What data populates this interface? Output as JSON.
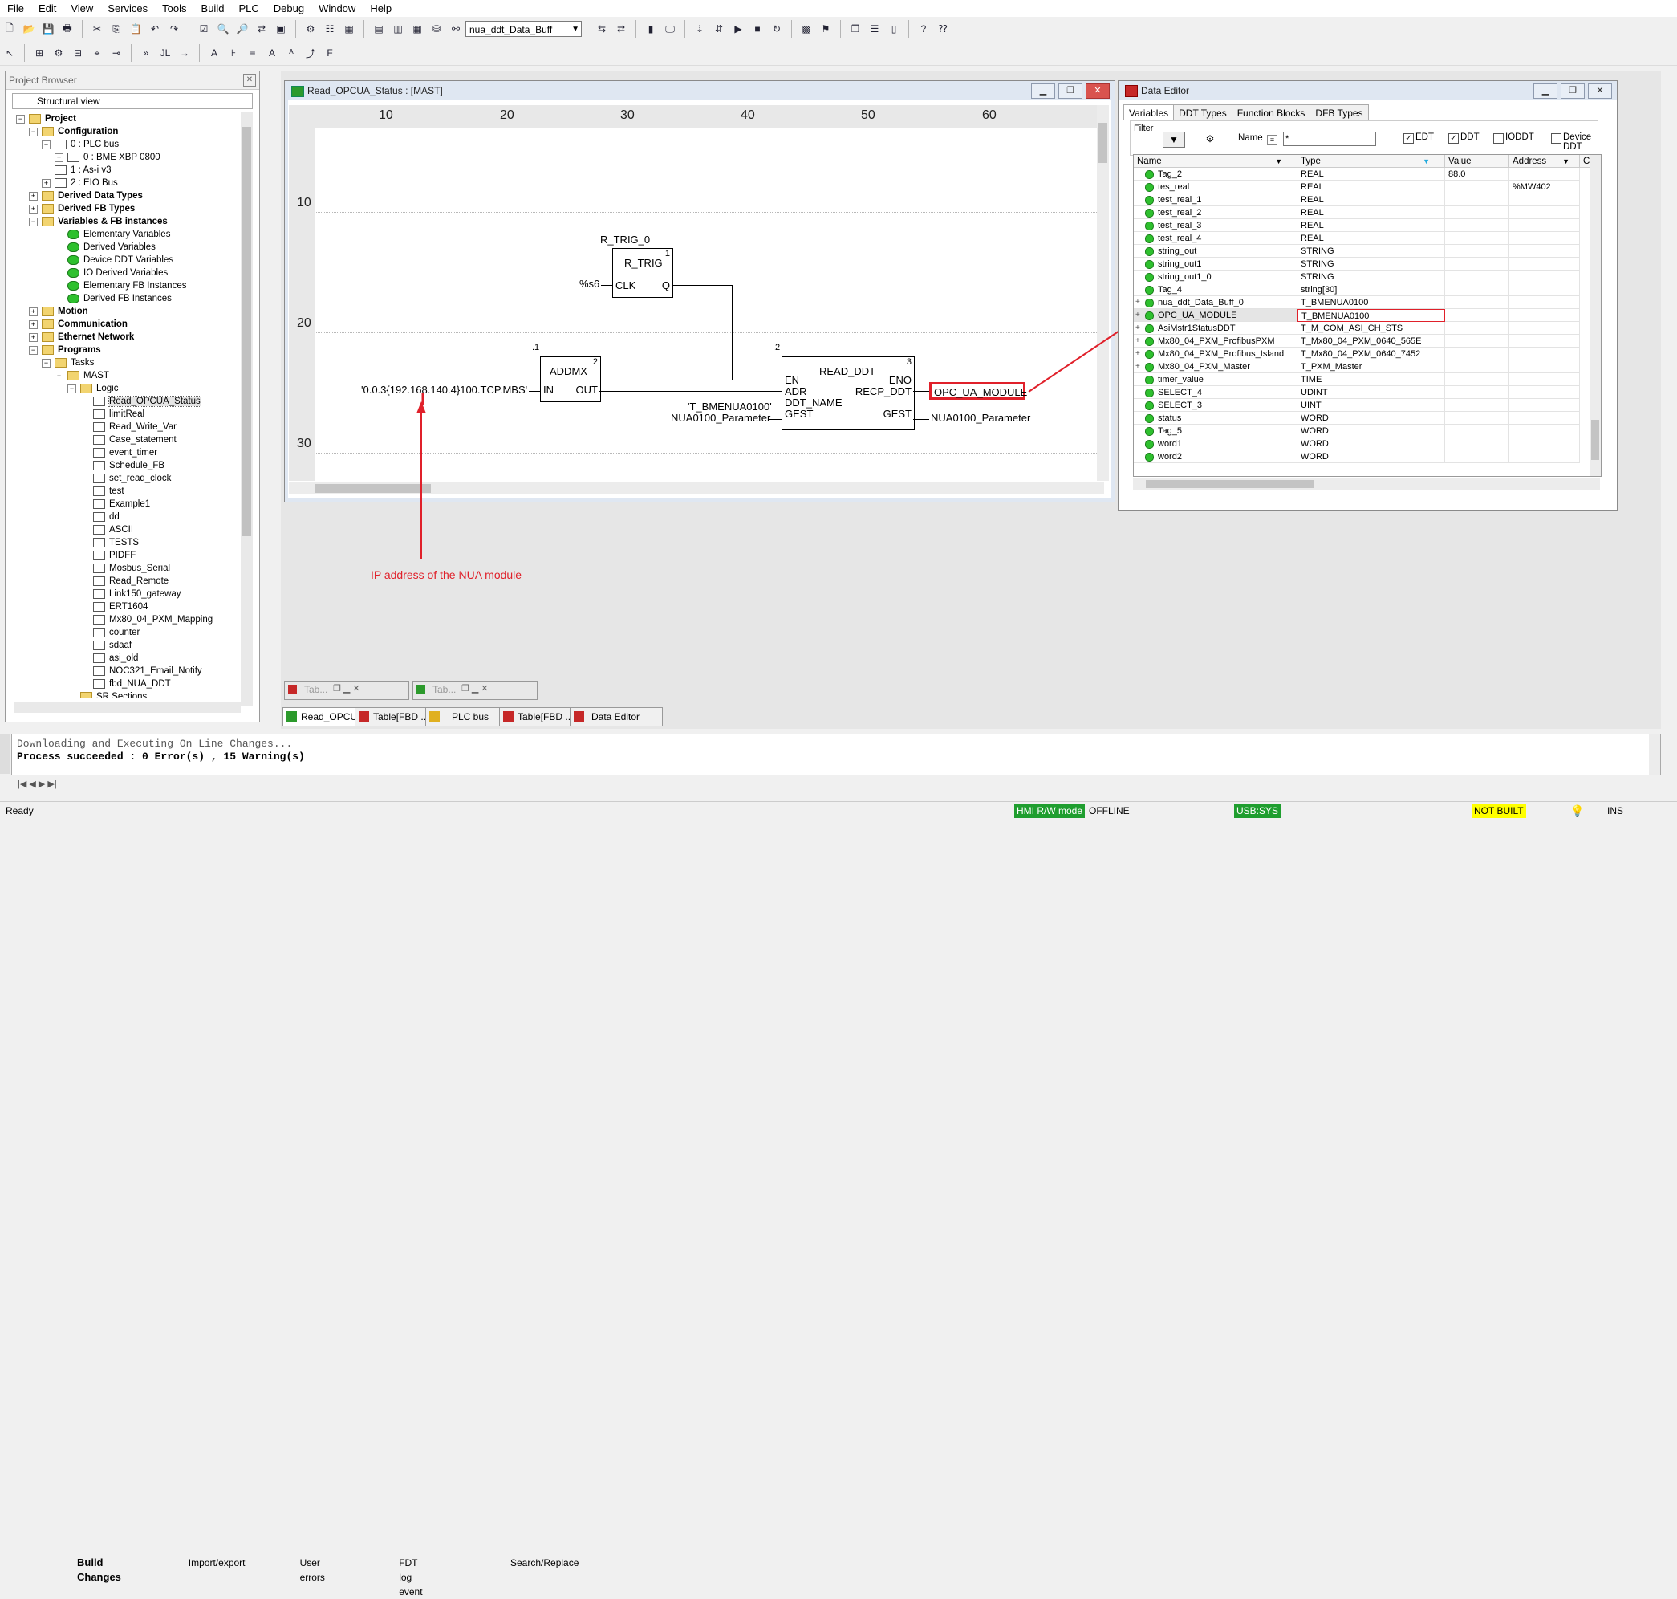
{
  "menu": [
    "File",
    "Edit",
    "View",
    "Services",
    "Tools",
    "Build",
    "PLC",
    "Debug",
    "Window",
    "Help"
  ],
  "toolbar": {
    "combo_value": "nua_ddt_Data_Buff"
  },
  "project_browser": {
    "title": "Project Browser",
    "view": "Structural view",
    "items": [
      {
        "label": "Project",
        "bold": true
      },
      {
        "label": "Configuration",
        "bold": true
      },
      {
        "label": "0 : PLC bus"
      },
      {
        "label": "0 : BME XBP 0800"
      },
      {
        "label": "1 : As-i v3"
      },
      {
        "label": "2 : EIO Bus"
      },
      {
        "label": "Derived Data Types",
        "bold": true
      },
      {
        "label": "Derived FB Types",
        "bold": true
      },
      {
        "label": "Variables & FB instances",
        "bold": true
      },
      {
        "label": "Elementary Variables"
      },
      {
        "label": "Derived Variables"
      },
      {
        "label": "Device DDT Variables"
      },
      {
        "label": "IO Derived Variables"
      },
      {
        "label": "Elementary FB Instances"
      },
      {
        "label": "Derived FB Instances"
      },
      {
        "label": "Motion",
        "bold": true
      },
      {
        "label": "Communication",
        "bold": true
      },
      {
        "label": "Ethernet Network",
        "bold": true
      },
      {
        "label": "Programs",
        "bold": true
      },
      {
        "label": "Tasks"
      },
      {
        "label": "MAST"
      },
      {
        "label": "Logic"
      },
      {
        "label": "Read_OPCUA_Status"
      },
      {
        "label": "limitReal"
      },
      {
        "label": "Read_Write_Var"
      },
      {
        "label": "Case_statement"
      },
      {
        "label": "event_timer"
      },
      {
        "label": "Schedule_FB"
      },
      {
        "label": "set_read_clock"
      },
      {
        "label": "test"
      },
      {
        "label": "Example1"
      },
      {
        "label": "dd"
      },
      {
        "label": "ASCII"
      },
      {
        "label": "TESTS"
      },
      {
        "label": "PIDFF"
      },
      {
        "label": "Mosbus_Serial"
      },
      {
        "label": "Read_Remote"
      },
      {
        "label": "Link150_gateway"
      },
      {
        "label": "ERT1604"
      },
      {
        "label": "Mx80_04_PXM_Mapping"
      },
      {
        "label": "counter"
      },
      {
        "label": "sdaaf"
      },
      {
        "label": "asi_old"
      },
      {
        "label": "NOC321_Email_Notify"
      },
      {
        "label": "fbd_NUA_DDT"
      },
      {
        "label": "SR Sections"
      }
    ]
  },
  "fbd": {
    "title": "Read_OPCUA_Status : [MAST]",
    "col_numbers": [
      "10",
      "20",
      "30",
      "40",
      "50",
      "60"
    ],
    "row_numbers": [
      "10",
      "20",
      "30"
    ],
    "rtrig": {
      "instance": "R_TRIG_0",
      "name": "R_TRIG",
      "num": "1",
      "in_pin": "CLK",
      "out_pin": "Q",
      "input": "%s6"
    },
    "addmx": {
      "name": "ADDMX",
      "num": "2",
      "order": ".1",
      "in_pin": "IN",
      "out_pin": "OUT",
      "input": "'0.0.3{192.168.140.4}100.TCP.MBS'"
    },
    "read_ddt": {
      "name": "READ_DDT",
      "num": "3",
      "order": ".2",
      "pins_in": [
        "EN",
        "ADR",
        "DDT_NAME",
        "GEST"
      ],
      "pins_out": [
        "ENO",
        "RECP_DDT",
        "GEST"
      ],
      "ddt_name_in": "'T_BMENUA0100'",
      "gest_in": "NUA0100_Parameter",
      "recp_out": "OPC_UA_MODULE",
      "gest_out": "NUA0100_Parameter"
    },
    "annotation": "IP address of the NUA module"
  },
  "data_editor": {
    "title": "Data Editor",
    "tabs": [
      "Variables",
      "DDT Types",
      "Function Blocks",
      "DFB Types"
    ],
    "filter_label": "Filter",
    "name_label": "Name",
    "name_value": "*",
    "checks": [
      {
        "label": "EDT",
        "checked": true
      },
      {
        "label": "DDT",
        "checked": true
      },
      {
        "label": "IODDT",
        "checked": false
      },
      {
        "label": "Device DDT",
        "checked": false
      }
    ],
    "columns": [
      "Name",
      "Type",
      "Value",
      "Address",
      "C"
    ],
    "rows": [
      {
        "name": "Tag_2",
        "type": "REAL",
        "value": "88.0",
        "address": ""
      },
      {
        "name": "tes_real",
        "type": "REAL",
        "value": "",
        "address": "%MW402"
      },
      {
        "name": "test_real_1",
        "type": "REAL",
        "value": "",
        "address": ""
      },
      {
        "name": "test_real_2",
        "type": "REAL",
        "value": "",
        "address": ""
      },
      {
        "name": "test_real_3",
        "type": "REAL",
        "value": "",
        "address": ""
      },
      {
        "name": "test_real_4",
        "type": "REAL",
        "value": "",
        "address": ""
      },
      {
        "name": "string_out",
        "type": "STRING",
        "value": "",
        "address": ""
      },
      {
        "name": "string_out1",
        "type": "STRING",
        "value": "",
        "address": ""
      },
      {
        "name": "string_out1_0",
        "type": "STRING",
        "value": "",
        "address": ""
      },
      {
        "name": "Tag_4",
        "type": "string[30]",
        "value": "",
        "address": ""
      },
      {
        "name": "nua_ddt_Data_Buff_0",
        "type": "T_BMENUA0100",
        "value": "",
        "address": "",
        "expand": true
      },
      {
        "name": "OPC_UA_MODULE",
        "type": "T_BMENUA0100",
        "value": "",
        "address": "",
        "expand": true,
        "highlight": true
      },
      {
        "name": "AsiMstr1StatusDDT",
        "type": "T_M_COM_ASI_CH_STS",
        "value": "",
        "address": "",
        "expand": true
      },
      {
        "name": "Mx80_04_PXM_ProfibusPXM",
        "type": "T_Mx80_04_PXM_0640_565E",
        "value": "",
        "address": "",
        "expand": true
      },
      {
        "name": "Mx80_04_PXM_Profibus_Island",
        "type": "T_Mx80_04_PXM_0640_7452",
        "value": "",
        "address": "",
        "expand": true
      },
      {
        "name": "Mx80_04_PXM_Master",
        "type": "T_PXM_Master",
        "value": "",
        "address": "",
        "expand": true
      },
      {
        "name": "timer_value",
        "type": "TIME",
        "value": "",
        "address": ""
      },
      {
        "name": "SELECT_4",
        "type": "UDINT",
        "value": "",
        "address": ""
      },
      {
        "name": "SELECT_3",
        "type": "UINT",
        "value": "",
        "address": ""
      },
      {
        "name": "status",
        "type": "WORD",
        "value": "",
        "address": ""
      },
      {
        "name": "Tag_5",
        "type": "WORD",
        "value": "",
        "address": ""
      },
      {
        "name": "word1",
        "type": "WORD",
        "value": "",
        "address": ""
      },
      {
        "name": "word2",
        "type": "WORD",
        "value": "",
        "address": ""
      }
    ]
  },
  "window_tabs": [
    "Read_OPCU...",
    "Table[FBD ...",
    "PLC bus",
    "Table[FBD ...",
    "Data Editor"
  ],
  "minimized_tabs": [
    "Tab...",
    "Tab..."
  ],
  "output": {
    "line1": "Downloading and Executing On Line Changes...",
    "line2": "Process succeeded : 0 Error(s) , 15 Warning(s)",
    "tabs": [
      "Build Changes",
      "Import/export",
      "User errors",
      "FDT log event",
      "Search/Replace"
    ]
  },
  "status": {
    "ready": "Ready",
    "hmi": "HMI R/W mode",
    "offline": "OFFLINE",
    "usb": "USB:SYS",
    "notbuilt": "NOT BUILT",
    "ins": "INS"
  },
  "colors": {
    "highlight_red": "#e0202a",
    "status_green": "#1f9e2f",
    "status_yellow": "#ffff00"
  }
}
